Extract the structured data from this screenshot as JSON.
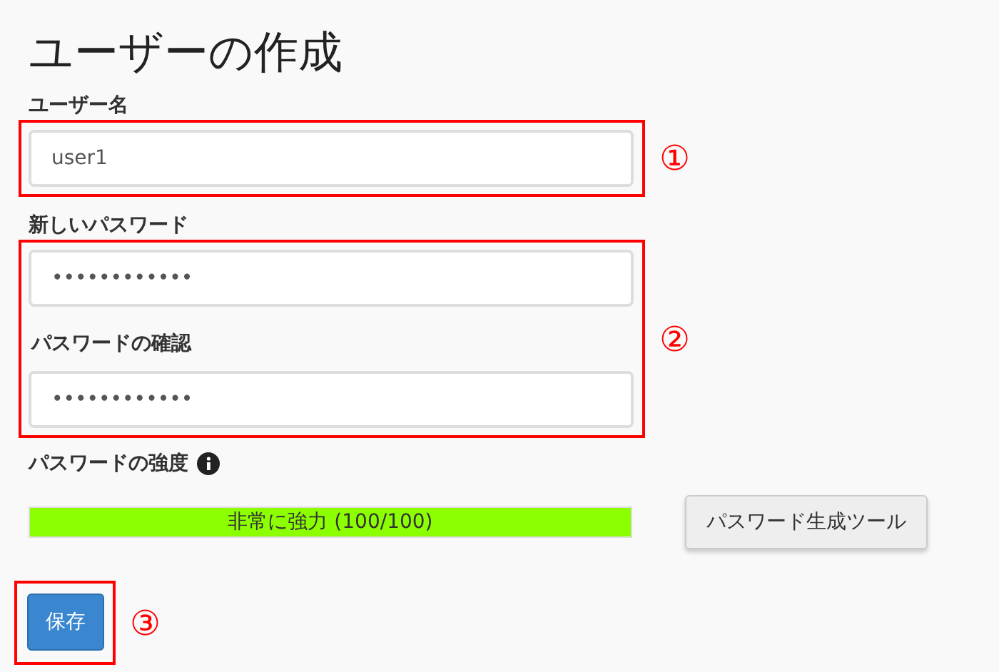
{
  "title": "ユーザーの作成",
  "username": {
    "label": "ユーザー名",
    "value": "user1",
    "callout": "①"
  },
  "password_group": {
    "callout": "②",
    "fields": [
      {
        "label": "新しいパスワード",
        "value": "••••••••••••"
      },
      {
        "label": "パスワードの確認",
        "value": "••••••••••••"
      }
    ]
  },
  "strength": {
    "label": "パスワードの強度",
    "level": 1,
    "reading": "非常に強力 (100/100)"
  },
  "generator_button": "パスワード生成ツール",
  "save": {
    "label": "保存",
    "callout": "③"
  }
}
